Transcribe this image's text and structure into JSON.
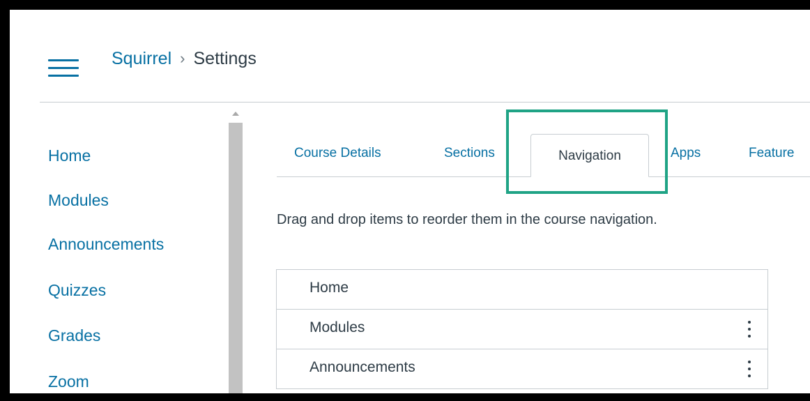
{
  "header": {
    "course_name": "Squirrel",
    "separator": "›",
    "current_page": "Settings"
  },
  "course_nav": {
    "items": [
      "Home",
      "Modules",
      "Announcements",
      "Quizzes",
      "Grades",
      "Zoom"
    ]
  },
  "tabs": {
    "items": [
      "Course Details",
      "Sections",
      "Navigation",
      "Apps",
      "Feature"
    ],
    "active": "Navigation"
  },
  "navigation_panel": {
    "instructions": "Drag and drop items to reorder them in the course navigation.",
    "items": [
      "Home",
      "Modules",
      "Announcements"
    ]
  },
  "colors": {
    "link": "#0770a3",
    "text": "#2d3b45",
    "highlight": "#1fa385",
    "border": "#c7cdd1"
  },
  "icons": {
    "menu": "hamburger-menu-icon",
    "item_options": "kebab-menu-icon"
  }
}
